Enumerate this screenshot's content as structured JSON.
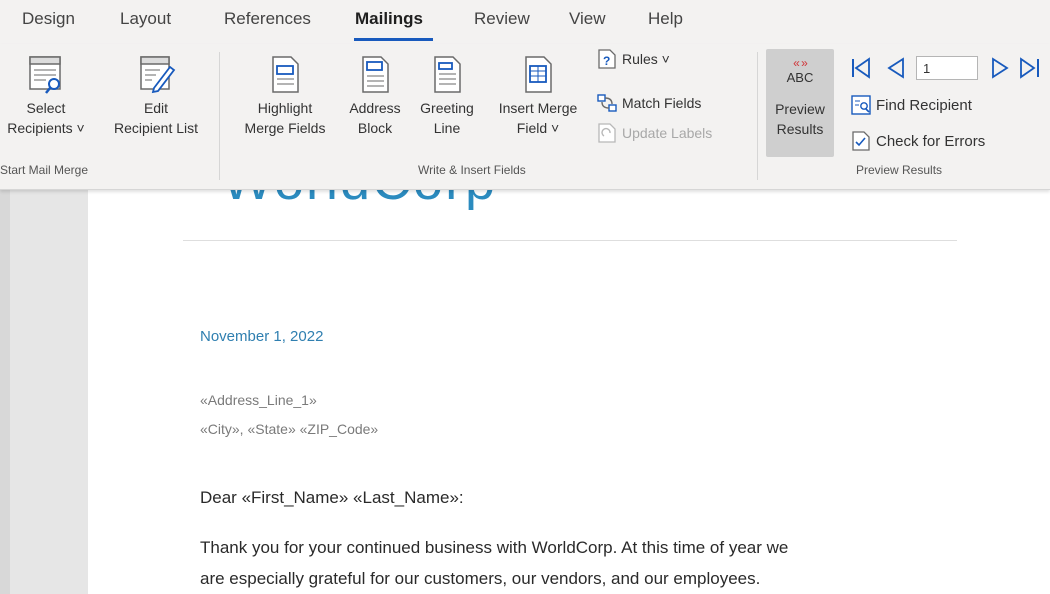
{
  "tabs": [
    "Design",
    "Layout",
    "References",
    "Mailings",
    "Review",
    "View",
    "Help"
  ],
  "active_tab": "Mailings",
  "ribbon": {
    "start_mail_merge": {
      "select_recipients": {
        "line1": "Select",
        "line2": "Recipients ˅"
      },
      "edit_recipient_list": {
        "line1": "Edit",
        "line2": "Recipient List"
      },
      "group_label": "Start Mail Merge"
    },
    "write_insert": {
      "highlight": {
        "line1": "Highlight",
        "line2": "Merge Fields"
      },
      "address_block": {
        "line1": "Address",
        "line2": "Block"
      },
      "greeting_line": {
        "line1": "Greeting",
        "line2": "Line"
      },
      "insert_merge_field": {
        "line1": "Insert Merge",
        "line2": "Field ˅"
      },
      "rules": "Rules ˅",
      "match_fields": "Match Fields",
      "update_labels": "Update Labels",
      "group_label": "Write & Insert Fields"
    },
    "preview": {
      "abc": "ABC",
      "preview_results": {
        "line1": "Preview",
        "line2": "Results"
      },
      "record_number": "1",
      "find_recipient": "Find Recipient",
      "check_errors": "Check for Errors",
      "group_label": "Preview Results"
    }
  },
  "document": {
    "logo": "WorldCorp",
    "date": "November 1, 2022",
    "address_line": "«Address_Line_1»",
    "city_state_zip": "«City», «State»  «ZIP_Code»",
    "greeting": "Dear «First_Name» «Last_Name»:",
    "body_line1": "Thank you for your continued business with WorldCorp.  At this time of year we",
    "body_line2": "are especially grateful for our customers, our vendors, and our employees."
  },
  "colors": {
    "accent": "#185abd",
    "preview_arrows": "#d13438",
    "doc_blue": "#2f7fb0"
  }
}
